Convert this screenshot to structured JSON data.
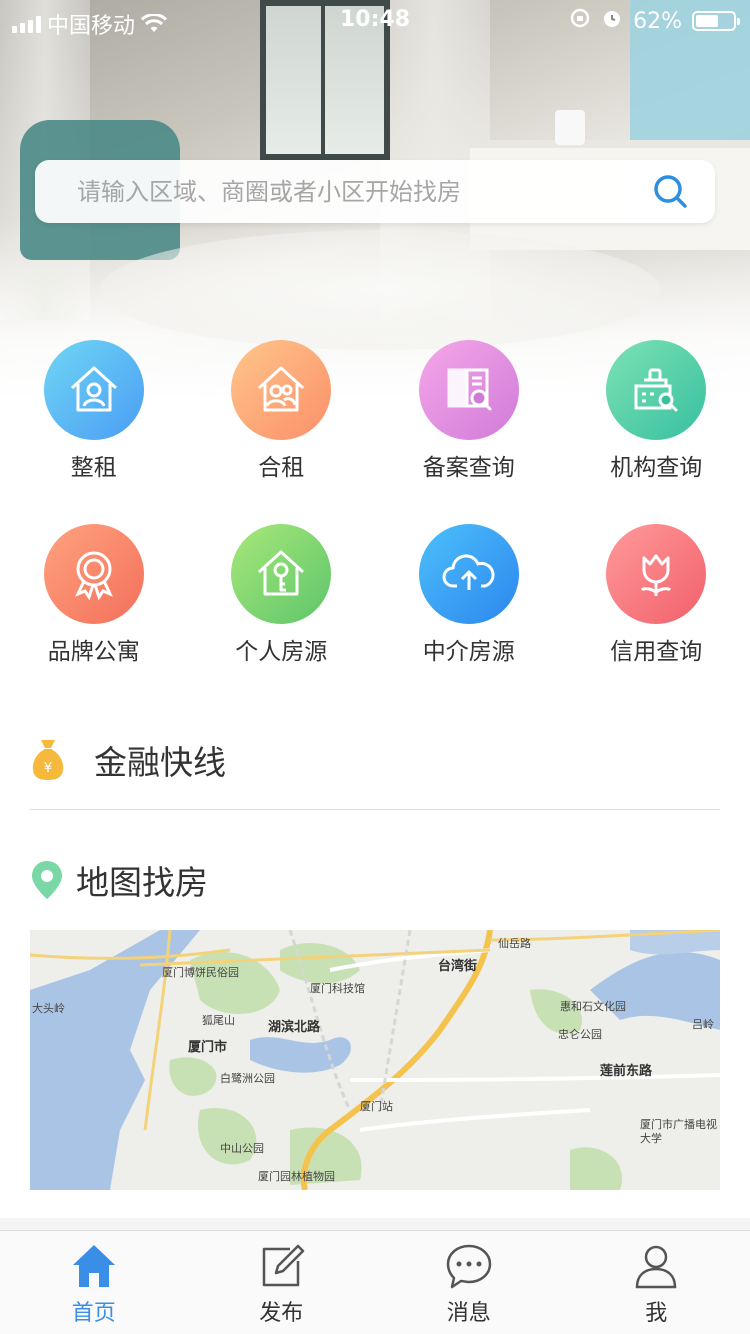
{
  "status_bar": {
    "carrier": "中国移动",
    "time": "10:48",
    "battery": "62%",
    "battery_level": 0.62
  },
  "search": {
    "placeholder": "请输入区域、商圈或者小区开始找房",
    "icon": "search-icon"
  },
  "categories": [
    {
      "label": "整租",
      "icon": "house-person-icon",
      "colors": [
        "#6fd6f5",
        "#4b9df3"
      ]
    },
    {
      "label": "合租",
      "icon": "house-people-icon",
      "colors": [
        "#ffc68a",
        "#fb8f6a"
      ]
    },
    {
      "label": "备案查询",
      "icon": "record-search-icon",
      "colors": [
        "#f5a8e8",
        "#d07ad9"
      ]
    },
    {
      "label": "机构查询",
      "icon": "building-search-icon",
      "colors": [
        "#7de2b4",
        "#37c0a0"
      ]
    },
    {
      "label": "品牌公寓",
      "icon": "badge-icon",
      "colors": [
        "#ffa27e",
        "#f3705b"
      ]
    },
    {
      "label": "个人房源",
      "icon": "house-key-icon",
      "colors": [
        "#a8e879",
        "#5dc56b"
      ]
    },
    {
      "label": "中介房源",
      "icon": "cloud-upload-icon",
      "colors": [
        "#4cc0fb",
        "#2d86ee"
      ]
    },
    {
      "label": "信用查询",
      "icon": "tulip-icon",
      "colors": [
        "#ff9a9a",
        "#f2606b"
      ]
    }
  ],
  "finance": {
    "title": "金融快线",
    "icon": "money-bag-icon"
  },
  "map_section": {
    "title": "地图找房",
    "icon": "location-pin-icon"
  },
  "map": {
    "labels": [
      "厦门博饼民俗园",
      "厦门科技馆",
      "台湾街",
      "仙岳路",
      "大头岭",
      "狐尾山",
      "湖滨北路",
      "惠和石文化园",
      "吕岭",
      "厦门市",
      "忠仑公园",
      "白鹭洲公园",
      "莲前东路",
      "厦门站",
      "中山公园",
      "厦门市广播电视大学",
      "厦门园林植物园"
    ]
  },
  "tabbar": {
    "items": [
      {
        "label": "首页",
        "icon": "home-icon",
        "active": true
      },
      {
        "label": "发布",
        "icon": "edit-icon",
        "active": false
      },
      {
        "label": "消息",
        "icon": "chat-bubble-icon",
        "active": false
      },
      {
        "label": "我",
        "icon": "user-icon",
        "active": false
      }
    ]
  },
  "colors": {
    "accent": "#3a8ee6",
    "finance_icon": "#f6b93b",
    "pin": "#7ad7a6"
  }
}
